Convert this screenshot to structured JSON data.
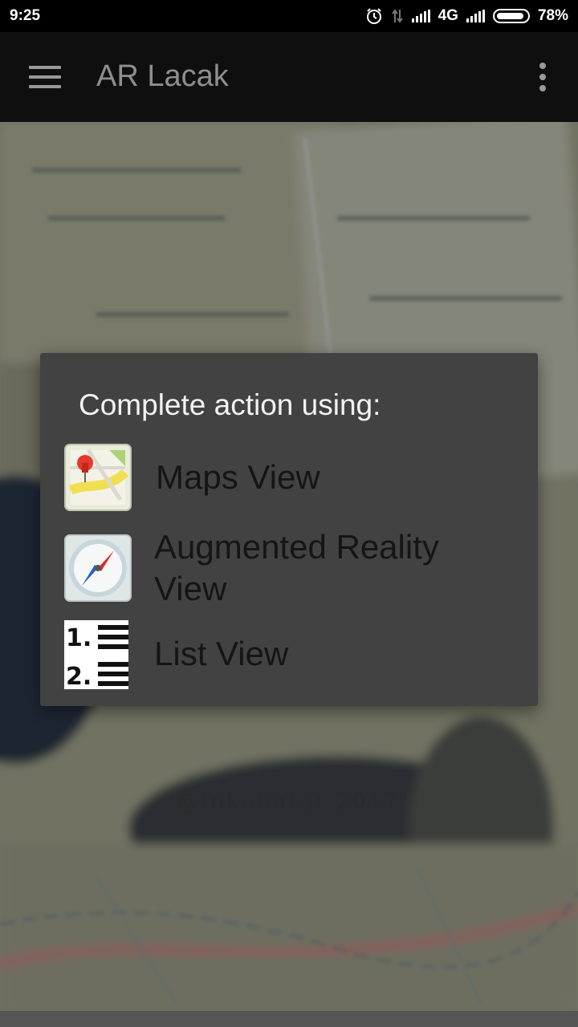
{
  "status_bar": {
    "time": "9:25",
    "network": "4G",
    "battery": "78%",
    "icons": [
      "alarm-icon",
      "data-transfer-icon",
      "signal-icon",
      "battery-icon"
    ]
  },
  "app_bar": {
    "title": "AR Lacak",
    "left_icon": "hamburger-menu-icon",
    "right_icon": "overflow-menu-icon"
  },
  "dialog": {
    "title": "Complete action using:",
    "options": [
      {
        "label": "Maps View",
        "icon": "maps-pin-icon"
      },
      {
        "label": "Augmented Reality View",
        "icon": "compass-icon"
      },
      {
        "label": "List View",
        "icon": "numbered-list-icon"
      }
    ]
  },
  "background": {
    "watermark": "@inkubator 2017"
  },
  "colors": {
    "app_bar": "#0f0f0f",
    "dialog": "#424242",
    "dialog_title": "#f2f2f2",
    "option_text": "#151515"
  }
}
